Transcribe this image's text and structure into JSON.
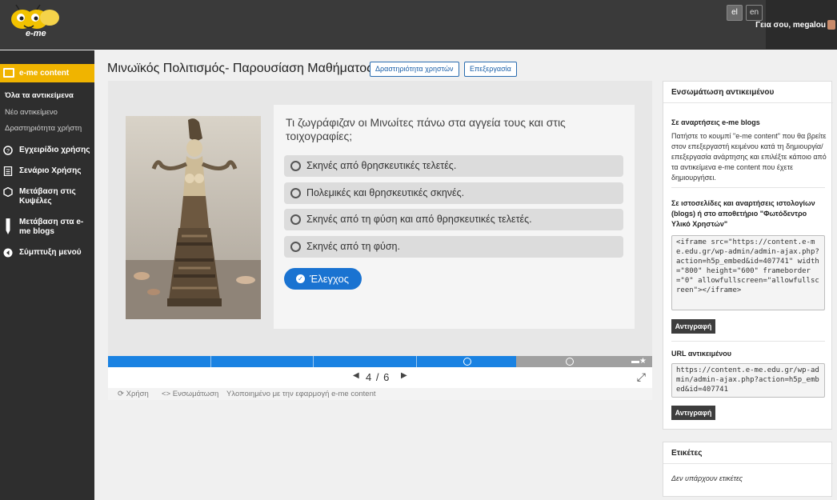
{
  "app": {
    "logo_text": "e-me",
    "lang_el": "el",
    "lang_en": "en",
    "greeting": "Γεια σου, megalou"
  },
  "sidebar": {
    "main_label": "e-me content",
    "sub_items": [
      "Όλα τα αντικείμενα",
      "Νέο αντικείμενο",
      "Δραστηριότητα χρήστη"
    ],
    "items": [
      {
        "label": "Εγχειρίδιο χρήσης",
        "icon": "help-icon"
      },
      {
        "label": "Σενάριο Χρήσης",
        "icon": "document-icon"
      },
      {
        "label": "Μετάβαση στις Κυψέλες",
        "icon": "hexagon-icon"
      },
      {
        "label": "Μετάβαση στα e-me blogs",
        "icon": "pencil-icon"
      },
      {
        "label": "Σύμπτυξη μενού",
        "icon": "collapse-icon"
      }
    ]
  },
  "header": {
    "title": "Μινωϊκός Πολιτισμός- Παρουσίαση Μαθήματος",
    "activity_button": "Δραστηριότητα χρηστών",
    "edit_button": "Επεξεργασία"
  },
  "quiz": {
    "question": "Τι ζωγράφιζαν οι Μινωίτες πάνω στα αγγεία τους και στις τοιχογραφίες;",
    "answers": [
      "Σκηνές από θρησκευτικές τελετές.",
      "Πολεμικές και θρησκευτικές σκηνές.",
      "Σκηνές από τη φύση και από θρησκευτικές τελετές.",
      "Σκηνές από τη φύση."
    ],
    "check_button": "Έλεγχος",
    "counter": "4 / 6",
    "progress_fraction": 0.75
  },
  "content_footer": {
    "reuse": "Χρήση",
    "embed": "<> Ενσωμάτωση",
    "powered": "Υλοποιημένο με την εφαρμογή e-me content"
  },
  "embed_panel": {
    "title": "Ενσωμάτωση αντικειμένου",
    "blogs_heading": "Σε αναρτήσεις e-me blogs",
    "blogs_text": "Πατήστε το κουμπί \"e-me content\" που θα βρείτε στον επεξεργαστή κειμένου κατά τη δημιουργία/επεξεργασία ανάρτησης και επιλέξτε κάποιο από τα αντικείμενα e-me content που έχετε δημιουργήσει.",
    "sites_heading": "Σε ιστοσελίδες και αναρτήσεις ιστολογίων (blogs) ή στο αποθετήριο \"Φωτόδεντρο Υλικό Χρηστών\"",
    "iframe_code": "<iframe src=\"https://content.e-me.edu.gr/wp-admin/admin-ajax.php?action=h5p_embed&id=407741\" width=\"800\" height=\"600\" frameborder=\"0\" allowfullscreen=\"allowfullscreen\"></iframe>",
    "copy_label": "Αντιγραφή",
    "url_heading": "URL αντικειμένου",
    "url_code": "https://content.e-me.edu.gr/wp-admin/admin-ajax.php?action=h5p_embed&id=407741",
    "copy_label_2": "Αντιγραφή"
  },
  "tags_panel": {
    "title": "Ετικέτες",
    "empty_text": "Δεν υπάρχουν ετικέτες"
  }
}
